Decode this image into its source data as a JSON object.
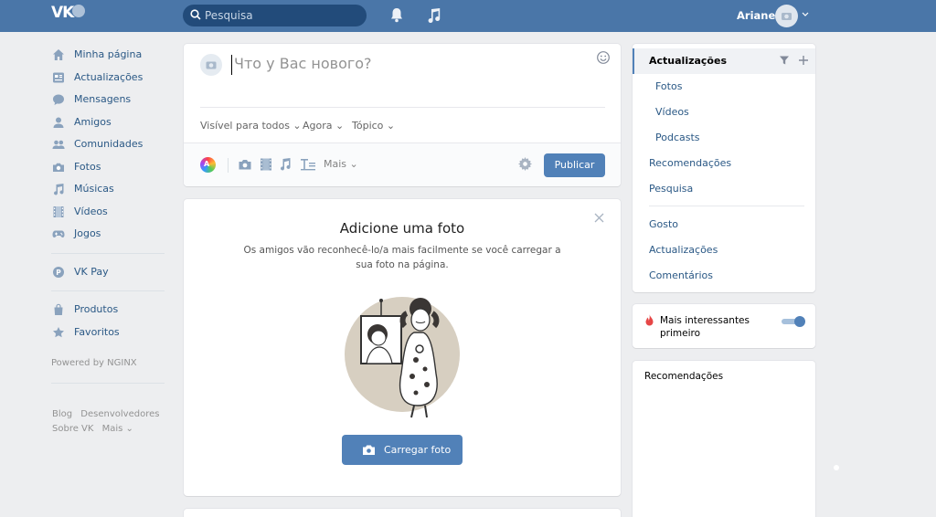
{
  "header": {
    "logo_text": "VK",
    "search_placeholder": "Pesquisa",
    "user_name": "Ariane"
  },
  "nav": {
    "items": [
      {
        "label": "Minha página",
        "icon": "home-icon"
      },
      {
        "label": "Actualizações",
        "icon": "news-icon"
      },
      {
        "label": "Mensagens",
        "icon": "messages-icon"
      },
      {
        "label": "Amigos",
        "icon": "friends-icon"
      },
      {
        "label": "Comunidades",
        "icon": "communities-icon"
      },
      {
        "label": "Fotos",
        "icon": "camera-icon"
      },
      {
        "label": "Músicas",
        "icon": "music-icon"
      },
      {
        "label": "Vídeos",
        "icon": "video-icon"
      },
      {
        "label": "Jogos",
        "icon": "gamepad-icon"
      }
    ],
    "vkpay": "VK Pay",
    "extras": [
      {
        "label": "Produtos",
        "icon": "bag-icon"
      },
      {
        "label": "Favoritos",
        "icon": "star-icon"
      }
    ],
    "powered_by": "Powered by NGINX",
    "footer": {
      "blog": "Blog",
      "devs": "Desenvolvedores",
      "about": "Sobre VK",
      "more": "Mais"
    }
  },
  "post": {
    "placeholder": "Что у Вас нового?",
    "visibility": "Visível para todos",
    "time": "Agora",
    "topic": "Tópico",
    "more": "Mais",
    "publish": "Publicar"
  },
  "add_photo": {
    "title": "Adicione uma foto",
    "description": "Os amigos vão reconhecê-lo/a mais facilmente se você carregar a sua foto na página.",
    "upload_button": "Carregar foto"
  },
  "right_menu": {
    "active": "Actualizações",
    "sub_items": [
      "Fotos",
      "Vídeos",
      "Podcasts"
    ],
    "items": [
      "Recomendações",
      "Pesquisa"
    ],
    "items2": [
      "Gosto",
      "Actualizações",
      "Comentários"
    ]
  },
  "toggle": {
    "label": "Mais interessantes primeiro",
    "on": true
  },
  "recommendations": {
    "title": "Recomendações"
  },
  "colors": {
    "header": "#4a76a8",
    "accent": "#5181b8",
    "link": "#2a5885",
    "background": "#edeef0"
  }
}
